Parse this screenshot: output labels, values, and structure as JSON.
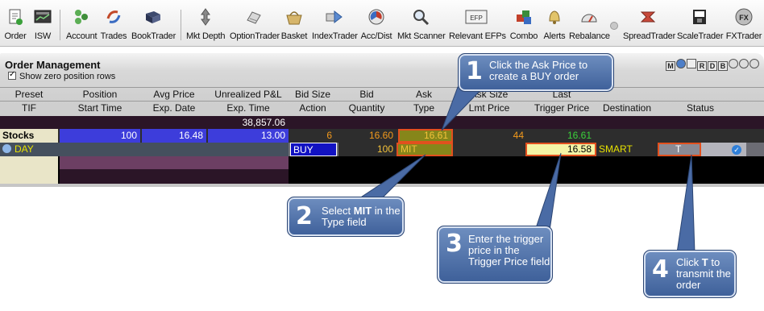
{
  "toolbar": {
    "items": [
      {
        "label": "Order",
        "icon": "order-icon"
      },
      {
        "label": "ISW",
        "icon": "isw-icon"
      },
      {
        "label": "Account",
        "icon": "account-icon"
      },
      {
        "label": "Trades",
        "icon": "trades-icon"
      },
      {
        "label": "BookTrader",
        "icon": "booktrader-icon"
      },
      {
        "label": "Mkt Depth",
        "icon": "mkt-depth-icon"
      },
      {
        "label": "OptionTrader",
        "icon": "optiontrader-icon"
      },
      {
        "label": "Basket",
        "icon": "basket-icon"
      },
      {
        "label": "IndexTrader",
        "icon": "indextrader-icon"
      },
      {
        "label": "Acc/Dist",
        "icon": "acc-dist-icon"
      },
      {
        "label": "Mkt Scanner",
        "icon": "mkt-scanner-icon"
      },
      {
        "label": "Relevant EFPs",
        "icon": "relevant-efps-icon",
        "badge": "EFP"
      },
      {
        "label": "Combo",
        "icon": "combo-icon"
      },
      {
        "label": "Alerts",
        "icon": "alerts-icon"
      },
      {
        "label": "Rebalance",
        "icon": "rebalance-icon"
      },
      {
        "label": "SpreadTrader",
        "icon": "spreadtrader-icon"
      },
      {
        "label": "ScaleTrader",
        "icon": "scaletrader-icon"
      },
      {
        "label": "FXTrader",
        "icon": "fxtrader-icon",
        "badge": "FX"
      }
    ]
  },
  "panel": {
    "title": "Order Management",
    "show_zero_label": "Show zero position rows",
    "buttons": [
      "M",
      "",
      "",
      "R",
      "D",
      "B",
      "",
      "",
      ""
    ]
  },
  "columns": {
    "top": [
      "Preset",
      "Position",
      "Avg Price",
      "Unrealized P&L",
      "Bid Size",
      "Bid",
      "Ask",
      "Ask Size",
      "Last",
      "",
      ""
    ],
    "bottom": [
      "TIF",
      "Start Time",
      "Exp. Date",
      "Exp. Time",
      "Action",
      "Quantity",
      "Type",
      "Lmt Price",
      "Trigger Price",
      "Destination",
      "Status"
    ]
  },
  "totals": {
    "unrealized_pnl": "38,857.06"
  },
  "stock_row": {
    "label": "Stocks",
    "position": "100",
    "avg_price": "16.48",
    "unrealized": "13.00",
    "bid_size": "6",
    "bid": "16.60",
    "ask": "16.61",
    "ask_size": "44",
    "last": "16.61"
  },
  "order_row": {
    "tif": "DAY",
    "action": "BUY",
    "quantity": "100",
    "type": "MIT",
    "trigger_price": "16.58",
    "destination": "SMART",
    "status": "T"
  },
  "callouts": [
    {
      "num": "1",
      "text": "Click the Ask Price to create a BUY order"
    },
    {
      "num": "2",
      "text_pre": "Select ",
      "text_bold": "MIT",
      "text_post": " in the Type field"
    },
    {
      "num": "3",
      "text": "Enter the trigger price in the Trigger Price field"
    },
    {
      "num": "4",
      "text_pre": "Click ",
      "text_bold": "T",
      "text_post": " to transmit the order"
    }
  ],
  "colors": {
    "position_bg": "#3b3bd8",
    "dark_row": "#2a1426",
    "highlight_ask": "#8a8a1a",
    "callout_bg": "#4a6ba5",
    "bid_orange": "#f39a1c",
    "last_green": "#3ad13a"
  }
}
